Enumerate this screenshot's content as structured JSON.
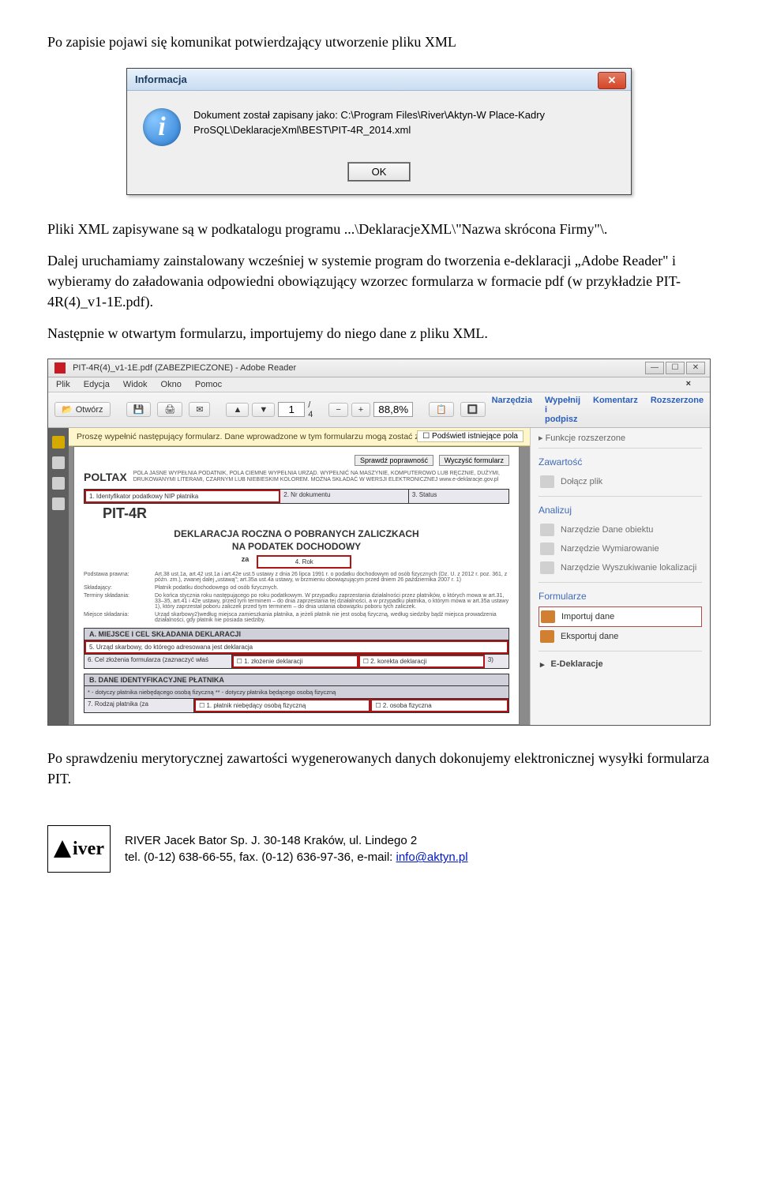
{
  "intro": {
    "para1": "Po zapisie pojawi się komunikat potwierdzający utworzenie pliku XML"
  },
  "dialog": {
    "title": "Informacja",
    "text_line1": "Dokument został zapisany jako: C:\\Program Files\\River\\Aktyn-W Place-Kadry",
    "text_line2": "ProSQL\\DeklaracjeXml\\BEST\\PIT-4R_2014.xml",
    "ok_label": "OK"
  },
  "body": {
    "path_line": "Pliki XML zapisywane są w podkatalogu programu ...\\DeklaracjeXML\\\"Nazwa skrócona Firmy\"\\.",
    "para2": "Dalej uruchamiamy zainstalowany wcześniej w systemie program do tworzenia e-deklaracji „Adobe Reader\" i wybieramy do załadowania odpowiedni obowiązujący wzorzec formularza w formacie pdf (w przykładzie PIT-4R(4)_v1-1E.pdf).",
    "para3": "Następnie w otwartym formularzu, importujemy do niego dane z pliku XML.",
    "end_para": "Po sprawdzeniu merytorycznej zawartości wygenerowanych danych dokonujemy elektronicznej wysyłki formularza PIT."
  },
  "reader": {
    "title": "PIT-4R(4)_v1-1E.pdf (ZABEZPIECZONE) - Adobe Reader",
    "menu": {
      "plik": "Plik",
      "edycja": "Edycja",
      "widok": "Widok",
      "okno": "Okno",
      "pomoc": "Pomoc"
    },
    "toolbar": {
      "open": "Otwórz",
      "page": "1",
      "pages": "/ 4",
      "zoom": "88,8%",
      "narzedzia": "Narzędzia",
      "wypelnij": "Wypełnij i podpisz",
      "komentarz": "Komentarz",
      "rozszerzone": "Rozszerzone"
    },
    "yellowbar": {
      "text": "Proszę wypełnić następujący formularz. Dane wprowadzone w tym formularzu mogą zostać zapisane.",
      "button": "Podświetl istniejące pola"
    },
    "page": {
      "btn_check": "Sprawdź poprawność",
      "btn_clear": "Wyczyść formularz",
      "poltax": "POLTAX",
      "poltax_desc": "POLA JASNE WYPEŁNIA PODATNIK, POLA CIEMNE WYPEŁNIA URZĄD. WYPEŁNIĆ NA MASZYNIE, KOMPUTEROWO LUB RĘCZNIE, DUŻYMI, DRUKOWANYMI LITERAMI, CZARNYM LUB NIEBIESKIM KOLOREM.  MOŻNA SKŁADAĆ W WERSJI ELEKTRONICZNEJ  www.e-deklaracje.gov.pl",
      "c1": "1. Identyfikator podatkowy NIP płatnika",
      "c2": "2. Nr dokumentu",
      "c3": "3. Status",
      "pit4r": "PIT-4R",
      "dektitle1": "DEKLARACJA ROCZNA  O POBRANYCH ZALICZKACH",
      "dektitle2": "NA PODATEK DOCHODOWY",
      "za": "za",
      "c4": "4. Rok",
      "legal_labels": {
        "l1": "Podstawa prawna:",
        "l2": "Składający:",
        "l3": "Terminy składania:",
        "l4": "Miejsce składania:"
      },
      "legal_values": {
        "v1": "Art.38 ust.1a, art.42 ust.1a i art.42e ust.5 ustawy z dnia 26 lipca 1991 r. o podatku dochodowym od osób fizycznych (Dz. U. z 2012 r. poz. 361, z późn. zm.), zwanej dalej „ustawą\"; art.35a ust.4a ustawy, w brzmieniu obowiązującym przed dniem 26 października 2007 r. 1)",
        "v2": "Płatnik podatku dochodowego od osób fizycznych.",
        "v3": "Do końca stycznia roku następującego po roku podatkowym. W przypadku zaprzestania działalności przez płatników, o których mowa w art.31, 33–35, art.41 i 42e ustawy, przed tym terminem – do dnia zaprzestania tej działalności, a w przypadku płatnika, o którym mowa w art.35a ustawy 1), który zaprzestał poboru zaliczek przed tym terminem – do dnia ustania obowiązku poboru tych zaliczek.",
        "v4": "Urząd skarbowy2)według miejsca zamieszkania płatnika, a jeżeli płatnik nie jest osobą fizyczną, według siedziby bądź miejsca prowadzenia działalności, gdy płatnik nie posiada siedziby."
      },
      "secA": "A. MIEJSCE I CEL SKŁADANIA DEKLARACJI",
      "a5": "5. Urząd skarbowy, do którego adresowana jest deklaracja",
      "a6": "6. Cel złożenia formularza (zaznaczyć właś",
      "a6_1": "1. złożenie deklaracji",
      "a6_2": "2. korekta deklaracji",
      "a6_sup": "3)",
      "secB": "B. DANE IDENTYFIKACYJNE PŁATNIKA",
      "b_foot": "* - dotyczy płatnika niebędącego osobą fizyczną          ** - dotyczy płatnika będącego osobą fizyczną",
      "b7": "7. Rodzaj płatnika (za",
      "b7_1": "1. płatnik niebędący osobą fizyczną",
      "b7_2": "2. osoba fizyczna"
    },
    "rightpanel": {
      "h1": "Funkcje rozszerzone",
      "zawartosc": "Zawartość",
      "dolacz": "Dołącz plik",
      "analizuj": "Analizuj",
      "obiekt": "Narzędzie Dane obiektu",
      "wymiar": "Narzędzie Wymiarowanie",
      "lokaliz": "Narzędzie Wyszukiwanie lokalizacji",
      "formularze": "Formularze",
      "import": "Importuj dane",
      "export": "Eksportuj dane",
      "edek": "E-Deklaracje"
    }
  },
  "footer": {
    "company": "RIVER Jacek Bator Sp. J. 30-148 Kraków, ul. Lindego 2",
    "contact_prefix": "tel. (0-12) 638-66-55, fax. (0-12) 636-97-36, e-mail: ",
    "email": "info@aktyn.pl",
    "logo_text": "iver"
  }
}
